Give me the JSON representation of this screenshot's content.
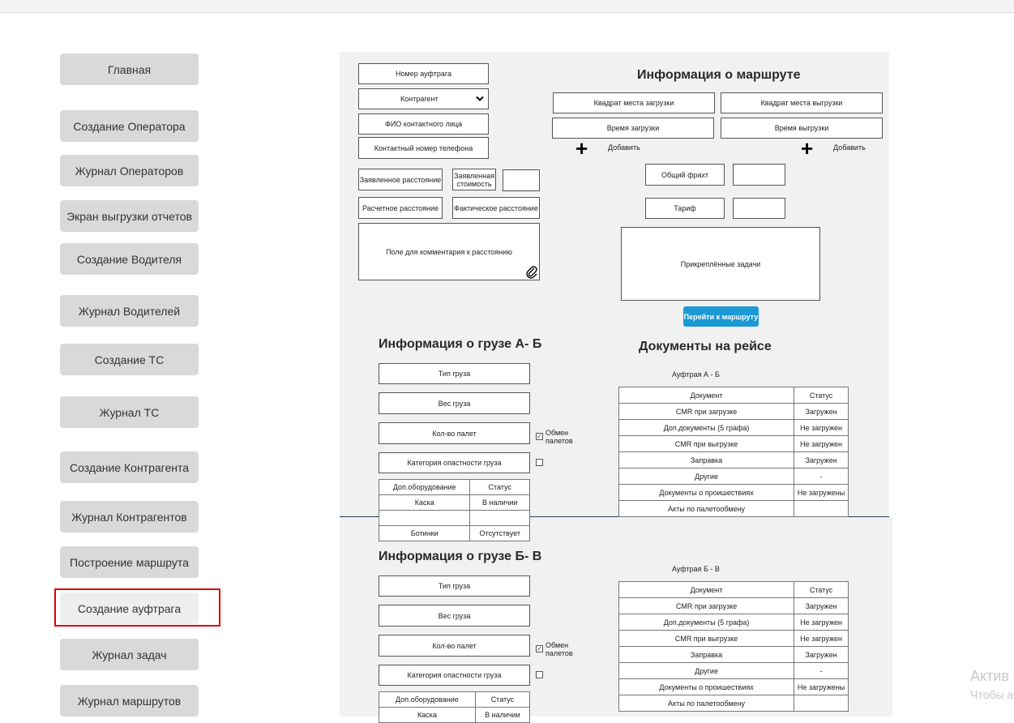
{
  "sidebar": {
    "items": [
      {
        "label": "Главная"
      },
      {
        "label": "Создание Оператора"
      },
      {
        "label": "Журнал Операторов"
      },
      {
        "label": "Экран выгрузки отчетов"
      },
      {
        "label": "Создание Водителя"
      },
      {
        "label": "Журнал Водителей"
      },
      {
        "label": "Создание ТС"
      },
      {
        "label": "Журнал ТС"
      },
      {
        "label": "Создание Контрагента"
      },
      {
        "label": "Журнал Контрагентов"
      },
      {
        "label": "Построение маршрута"
      },
      {
        "label": "Создание ауфтрага"
      },
      {
        "label": "Журнал задач"
      },
      {
        "label": "Журнал маршрутов"
      }
    ],
    "active_index": 11,
    "highlight_color": "#e00000"
  },
  "order": {
    "number": "Номер ауфтрага",
    "counterparty": "Контрагент",
    "contact_name": "ФИО контактного лица",
    "contact_phone": "Контактный номер телефона",
    "declared_distance": "Заявленное расстояние",
    "declared_cost": "Заявленная стоимость",
    "calculated_distance": "Расчетное расстояние",
    "actual_distance": "Фактическое расстояние",
    "distance_comment": "Поле для комментария к расстоянию"
  },
  "route": {
    "title": "Информация о маршруте",
    "load_square": "Квадрат места загрузки",
    "unload_square": "Квадрат места выгрузки",
    "load_time": "Время загрузки",
    "unload_time": "Время выгрузки",
    "add_label": "Добавить",
    "total_freight": "Общий фрахт",
    "tariff": "Тариф",
    "attached_tasks": "Прикреплённые задачи",
    "go_button": "Перейти к маршруту",
    "go_button_color": "#1b9ad6"
  },
  "cargo_ab": {
    "title": "Информация о грузе А- Б",
    "cargo_type": "Тип груза",
    "weight": "Вес груза",
    "pallets": "Кол-во палет",
    "pallet_exchange": "Обмен палетов",
    "hazard": "Категория опастности груза",
    "equipment_headers": [
      "Доп.оборудование",
      "Статус"
    ],
    "equipment_rows": [
      [
        "Каска",
        "В наличии"
      ],
      [
        "",
        ""
      ],
      [
        "Ботинки",
        "Отсутствует"
      ]
    ]
  },
  "cargo_bv": {
    "title": "Информация о грузе Б- В",
    "cargo_type": "Тип груза",
    "weight": "Вес груза",
    "pallets": "Кол-во палет",
    "pallet_exchange": "Обмен палетов",
    "hazard": "Категория опастности груза",
    "equipment_headers": [
      "Доп.оборудование",
      "Статус"
    ],
    "equipment_rows": [
      [
        "Каска",
        "В наличии"
      ]
    ]
  },
  "documents": {
    "title": "Документы на рейсе",
    "auftrag_ab": "Ауфтрая А - Б",
    "auftrag_bv": "Ауфтрая Б - В",
    "headers": [
      "Документ",
      "Статус"
    ],
    "rows_ab": [
      [
        "CMR при загрузке",
        "Загружен"
      ],
      [
        "Доп.документы (5 графа)",
        "Не загружен"
      ],
      [
        "CMR при выгрузке",
        "Не загружен"
      ],
      [
        "Заправка",
        "Загружен"
      ],
      [
        "Другие",
        "-"
      ],
      [
        "Документы о проишествиях",
        "Не загружены"
      ],
      [
        "Акты по палетообмену",
        ""
      ]
    ],
    "rows_bv": [
      [
        "CMR при загрузке",
        "Загружен"
      ],
      [
        "Доп.документы (5 графа)",
        "Не загружен"
      ],
      [
        "CMR при выгрузке",
        "Не загружен"
      ],
      [
        "Заправка",
        "Загружен"
      ],
      [
        "Другие",
        "-"
      ],
      [
        "Документы о проишествиях",
        "Не загружены"
      ],
      [
        "Акты по палетообмену",
        ""
      ]
    ]
  },
  "watermark": {
    "line1": "Актив",
    "line2": "Чтобы а"
  }
}
